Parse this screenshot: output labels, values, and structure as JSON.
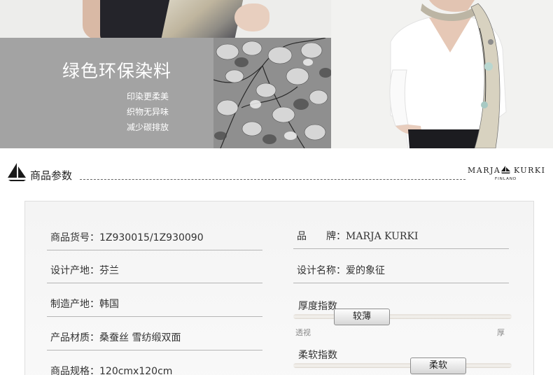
{
  "banner": {
    "title": "绿色环保染料",
    "lines": [
      "印染更柔美",
      "织物无异味",
      "减少碳排放"
    ]
  },
  "section": {
    "title": "商品参数",
    "brand_name_left": "MARJA",
    "brand_name_right": "KURKI",
    "brand_sub": "FINLAND"
  },
  "params": {
    "left": [
      "商品货号：1Z930015/1Z930090",
      "设计产地：芬兰",
      "制造产地：韩国",
      "产品材质：桑蚕丝 雪纺缎双面",
      "商品规格：120cmx120cm"
    ],
    "right": [
      "品　　牌：MARJA KURKI",
      "设计名称：爱的象征"
    ]
  },
  "sliders": {
    "thickness": {
      "title": "厚度指数",
      "value_label": "较薄",
      "min_label": "透视",
      "max_label": "厚",
      "level": 0.25
    },
    "softness": {
      "title": "柔软指数",
      "value_label": "柔软",
      "level": 0.72
    }
  },
  "colors": {
    "banner_grey": "#a3a3a3",
    "text": "#333333",
    "panel_border": "#dedede"
  }
}
